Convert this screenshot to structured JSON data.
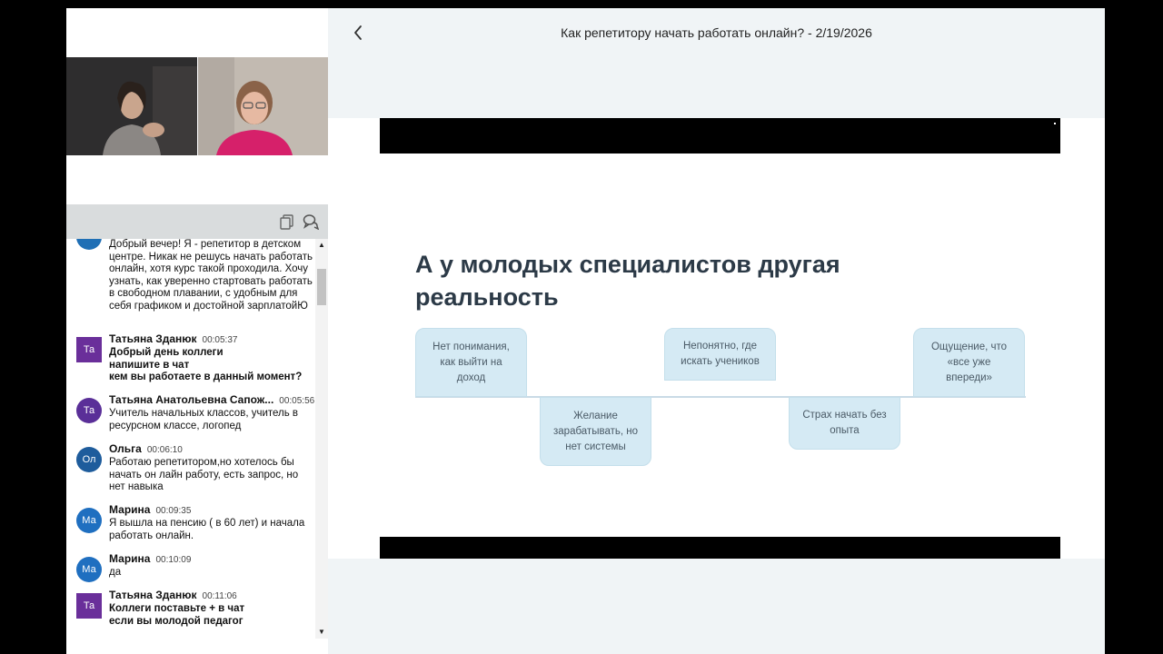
{
  "header": {
    "title": "Как репетитору начать работать онлайн? - 2/19/2026"
  },
  "icons": {
    "back": "chevron-left-icon",
    "copy": "copy-icon",
    "chat": "chat-bubbles-icon"
  },
  "chat": {
    "messages": [
      {
        "initials": "",
        "name": "",
        "time": "",
        "avatar_color": "#1f6fb5",
        "text": "Добрый вечер!  Я - репетитор в детском центре. Никак не решусь начать работать онлайн, хотя курс такой проходила. Хочу узнать, как уверенно стартовать работать в свободном плавании, с удобным для себя графиком и достойной зарплатойЮ",
        "bold": false
      },
      {
        "initials": "Та",
        "name": "Татьяна Зданюк",
        "time": "00:05:37",
        "avatar_color": "#6a2f9a",
        "text": "Добрый день коллеги\nнапишите в чат\nкем вы работаете в данный момент?",
        "bold": true
      },
      {
        "initials": "Та",
        "name": "Татьяна Анатольевна Сапож...",
        "time": "00:05:56",
        "avatar_color": "#5a2f98",
        "text": "Учитель начальных классов, учитель в ресурсном классе, логопед",
        "bold": false
      },
      {
        "initials": "Ол",
        "name": "Ольга",
        "time": "00:06:10",
        "avatar_color": "#1e5c9c",
        "text": "Работаю репетитором,но хотелось бы начать он лайн работу, есть запрос, но нет навыка",
        "bold": false
      },
      {
        "initials": "Ма",
        "name": "Марина",
        "time": "00:09:35",
        "avatar_color": "#1f6fc0",
        "text": "Я вышла на пенсию ( в 60 лет) и начала работать онлайн.",
        "bold": false
      },
      {
        "initials": "Ма",
        "name": "Марина",
        "time": "00:10:09",
        "avatar_color": "#1f6fc0",
        "text": "да",
        "bold": false
      },
      {
        "initials": "Та",
        "name": "Татьяна Зданюк",
        "time": "00:11:06",
        "avatar_color": "#6a2f9a",
        "text": "Коллеги поставьте + в чат\nесли вы молодой педагог",
        "bold": true
      }
    ]
  },
  "slide": {
    "heading": "А у молодых специалистов другая реальность",
    "boxes": [
      "Нет понимания, как выйти на доход",
      "Желание зарабатывать, но нет системы",
      "Непонятно, где искать учеников",
      "Страх начать без опыта",
      "Ощущение, что «все уже впереди»"
    ]
  }
}
